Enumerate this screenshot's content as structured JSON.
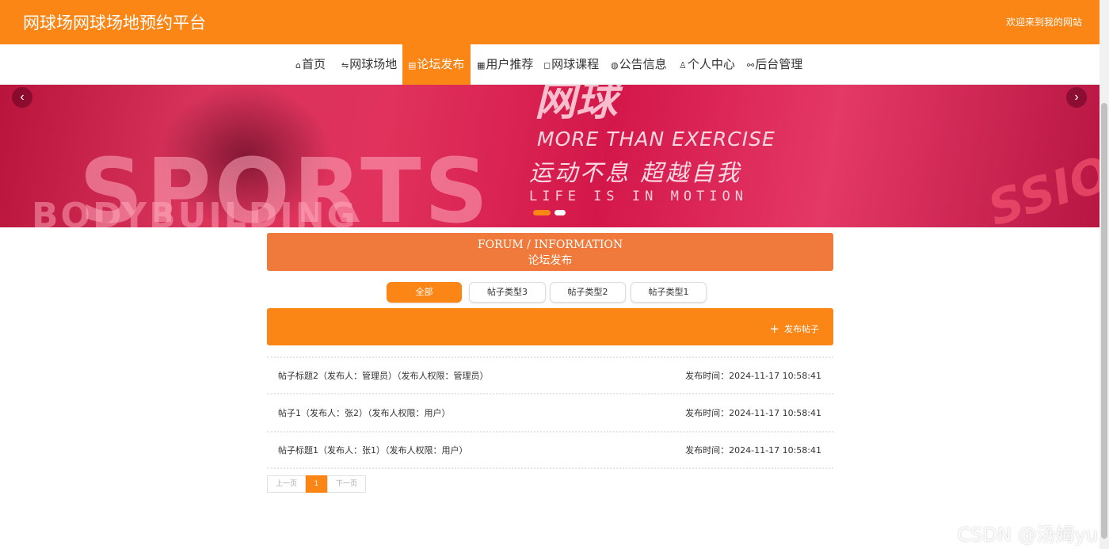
{
  "header": {
    "site_title": "网球场网球场地预约平台",
    "welcome": "欢迎来到我的网站"
  },
  "nav": {
    "items": [
      {
        "label": "首页",
        "icon": "⌂"
      },
      {
        "label": "网球场地",
        "icon": "⇋"
      },
      {
        "label": "论坛发布",
        "icon": "▤"
      },
      {
        "label": "用户推荐",
        "icon": "▦"
      },
      {
        "label": "网球课程",
        "icon": "◻"
      },
      {
        "label": "公告信息",
        "icon": "◍"
      },
      {
        "label": "个人中心",
        "icon": "♙"
      },
      {
        "label": "后台管理",
        "icon": "⚯"
      }
    ],
    "active_label": "论坛发布"
  },
  "banner": {
    "brand_text": "网球",
    "line1": "MORE THAN EXERCISE",
    "line2": "运动不息 超越自我",
    "line3": "LIFE IS IN MOTION",
    "bg_text_1": "SPORTS",
    "bg_text_2": "BODYBUILDING",
    "bg_text_3": "SSION",
    "prev_icon": "‹",
    "next_icon": "›",
    "slide_count": 2,
    "active_slide": 1
  },
  "forum": {
    "title_en": "FORUM / INFORMATION",
    "title_zh": "论坛发布"
  },
  "filters": [
    {
      "label": "全部",
      "active": true
    },
    {
      "label": "帖子类型3",
      "active": false
    },
    {
      "label": "帖子类型2",
      "active": false
    },
    {
      "label": "帖子类型1",
      "active": false
    }
  ],
  "post_button": {
    "label": "发布帖子",
    "icon": "+"
  },
  "posts": [
    {
      "title": "帖子标题2（发布人：管理员）（发布人权限：管理员）",
      "time": "发布时间：2024-11-17 10:58:41"
    },
    {
      "title": "帖子1（发布人：张2）（发布人权限：用户）",
      "time": "发布时间：2024-11-17 10:58:41"
    },
    {
      "title": "帖子标题1（发布人：张1）（发布人权限：用户）",
      "time": "发布时间：2024-11-17 10:58:41"
    }
  ],
  "pagination": {
    "prev": "上一页",
    "current": "1",
    "next": "下一页"
  },
  "watermark": "CSDN @汤姆yu",
  "colors": {
    "accent": "#fb8515",
    "forum_header": "#f07a3b",
    "banner": "#d8335a"
  }
}
